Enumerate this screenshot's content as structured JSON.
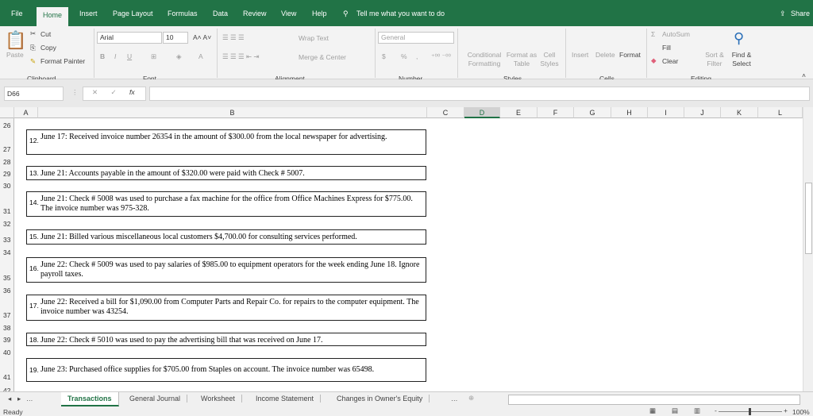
{
  "ribbon_tabs": [
    "File",
    "Home",
    "Insert",
    "Page Layout",
    "Formulas",
    "Data",
    "Review",
    "View",
    "Help"
  ],
  "tell_me": "Tell me what you want to do",
  "share": "Share",
  "clipboard": {
    "paste": "Paste",
    "cut": "Cut",
    "copy": "Copy",
    "format_painter": "Format Painter",
    "label": "Clipboard"
  },
  "font": {
    "name": "Arial",
    "size": "10",
    "label": "Font"
  },
  "alignment": {
    "wrap": "Wrap Text",
    "merge": "Merge & Center",
    "label": "Alignment"
  },
  "number": {
    "format": "General",
    "currency": "$",
    "percent": "%",
    "comma": ",",
    "label": "Number"
  },
  "styles": {
    "conditional": "Conditional Formatting",
    "format_table": "Format as Table",
    "cell_styles": "Cell Styles",
    "label": "Styles"
  },
  "cells": {
    "insert": "Insert",
    "delete": "Delete",
    "format": "Format",
    "label": "Cells"
  },
  "editing": {
    "autosum": "AutoSum",
    "fill": "Fill",
    "clear": "Clear",
    "sort": "Sort & Filter",
    "find": "Find & Select",
    "label": "Editing"
  },
  "name_box": "D66",
  "formula": "",
  "columns": [
    "A",
    "B",
    "C",
    "D",
    "E",
    "F",
    "G",
    "H",
    "I",
    "J",
    "K",
    "L"
  ],
  "selected_column": "D",
  "rows": [
    "26",
    "27",
    "28",
    "29",
    "30",
    "31",
    "32",
    "33",
    "34",
    "35",
    "36",
    "37",
    "38",
    "39",
    "40",
    "41",
    "42"
  ],
  "entries": [
    {
      "num": "12.",
      "text": "June 17:  Received invoice number 26354 in the amount of $300.00 from the local newspaper for advertising."
    },
    {
      "num": "13.",
      "text": "June 21:  Accounts payable in the amount of $320.00 were paid with Check # 5007."
    },
    {
      "num": "14.",
      "text": "June 21:  Check # 5008 was used to purchase a fax machine for the office from Office Machines Express for $775.00.  The invoice number was 975-328."
    },
    {
      "num": "15.",
      "text": "June 21: Billed various miscellaneous local customers $4,700.00 for consulting services performed."
    },
    {
      "num": "16.",
      "text": "June 22:  Check # 5009 was used to pay salaries of $985.00 to equipment operators for the week ending June 18.  Ignore payroll taxes."
    },
    {
      "num": "17.",
      "text": "June 22:  Received a bill for $1,090.00 from Computer Parts and Repair Co. for repairs to the computer equipment.  The invoice number was 43254."
    },
    {
      "num": "18.",
      "text": "June 22:  Check # 5010 was used to pay the advertising bill that was received on June 17."
    },
    {
      "num": "19.",
      "text": "June 23:  Purchased office supplies for $705.00 from Staples on account.  The invoice number was 65498."
    }
  ],
  "sheet_tabs": [
    "Transactions",
    "General Journal",
    "Worksheet",
    "Income Statement",
    "Changes in Owner's Equity"
  ],
  "active_sheet": "Transactions",
  "status": "Ready",
  "zoom": "100%",
  "colors": {
    "brand": "#217346"
  }
}
